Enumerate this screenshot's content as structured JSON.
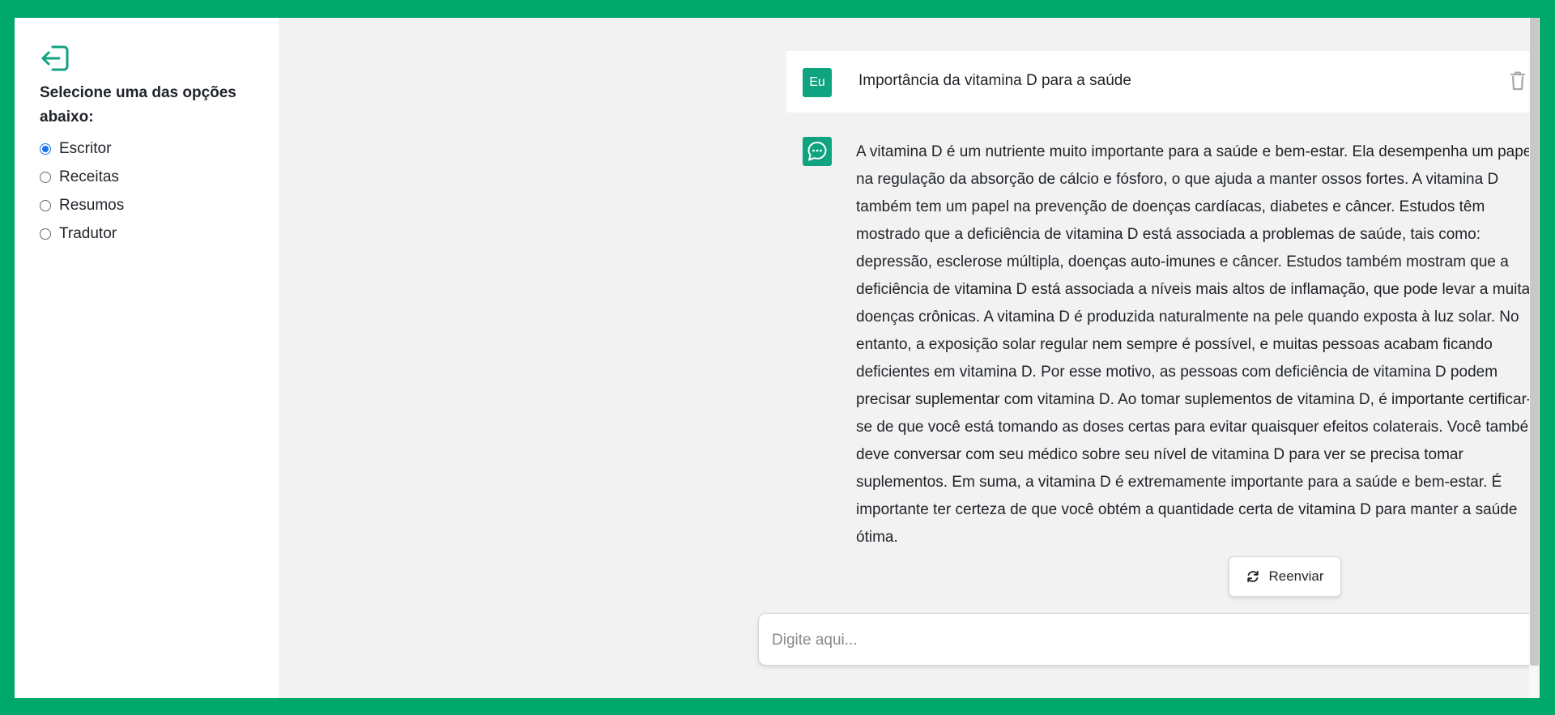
{
  "sidebar": {
    "logout_icon": "logout-icon",
    "title": "Selecione uma das opções abaixo:",
    "options": [
      {
        "label": "Escritor",
        "selected": true
      },
      {
        "label": "Receitas",
        "selected": false
      },
      {
        "label": "Resumos",
        "selected": false
      },
      {
        "label": "Tradutor",
        "selected": false
      }
    ]
  },
  "chat": {
    "user_message": {
      "avatar_label": "Eu",
      "text": "Importância da vitamina D para a saúde",
      "delete_icon": "trash-icon"
    },
    "bot_message": {
      "avatar_icon": "chat-bubble-icon",
      "text": "A vitamina D é um nutriente muito importante para a saúde e bem-estar. Ela desempenha um papel na regulação da absorção de cálcio e fósforo, o que ajuda a manter ossos fortes. A vitamina D também tem um papel na prevenção de doenças cardíacas, diabetes e câncer. Estudos têm mostrado que a deficiência de vitamina D está associada a problemas de saúde, tais como: depressão, esclerose múltipla, doenças auto-imunes e câncer. Estudos também mostram que a deficiência de vitamina D está associada a níveis mais altos de inflamação, que pode levar a muitas doenças crônicas. A vitamina D é produzida naturalmente na pele quando exposta à luz solar. No entanto, a exposição solar regular nem sempre é possível, e muitas pessoas acabam ficando deficientes em vitamina D. Por esse motivo, as pessoas com deficiência de vitamina D podem precisar suplementar com vitamina D. Ao tomar suplementos de vitamina D, é importante certificar-se de que você está tomando as doses certas para evitar quaisquer efeitos colaterais. Você também deve conversar com seu médico sobre seu nível de vitamina D para ver se precisa tomar suplementos. Em suma, a vitamina D é extremamente importante para a saúde e bem-estar. É importante ter certeza de que você obtém a quantidade certa de vitamina D para manter a saúde ótima."
    },
    "resend_label": "Reenviar",
    "resend_icon": "refresh-icon"
  },
  "input": {
    "placeholder": "Digite aqui...",
    "value": "",
    "send_icon": "send-icon"
  },
  "colors": {
    "brand": "#00a86b",
    "accent": "#10a37f",
    "radio_selected": "#1a73e8"
  }
}
